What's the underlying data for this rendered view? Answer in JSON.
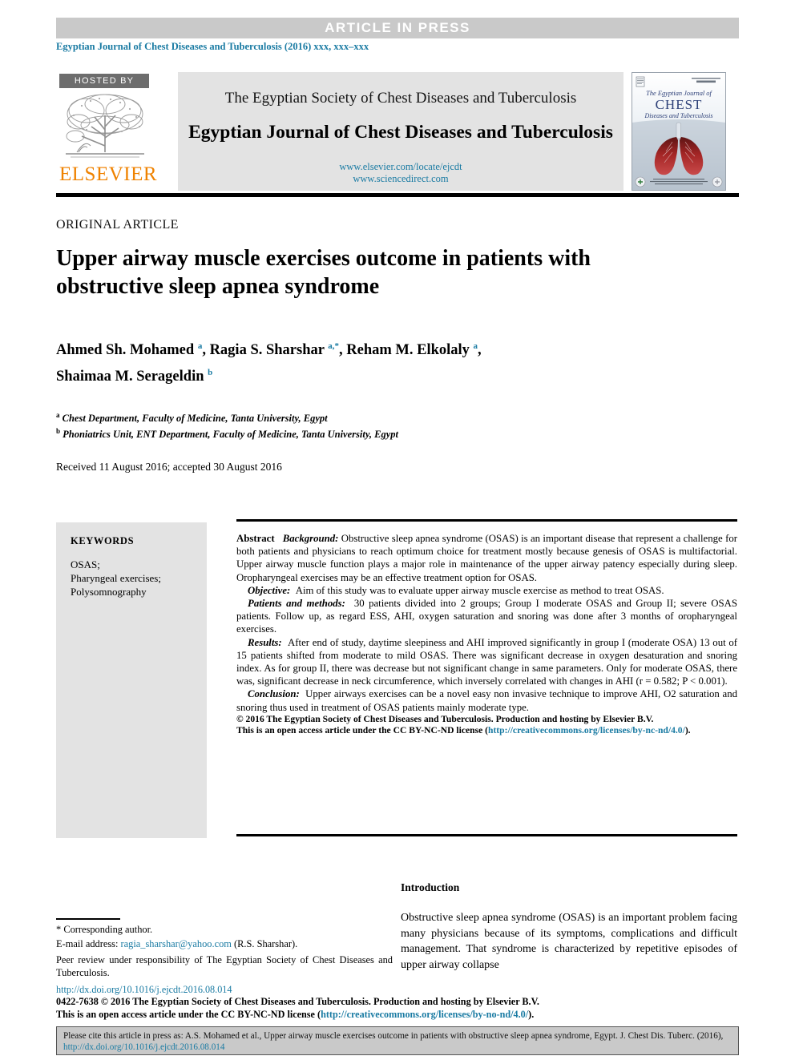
{
  "banner": {
    "label": "ARTICLE  IN  PRESS",
    "journal_reference": "Egyptian Journal of Chest Diseases and Tuberculosis (2016) xxx, xxx–xxx",
    "bar_color": "#c9c9c9",
    "link_color": "#1a7ba3"
  },
  "masthead": {
    "hosted_by": "HOSTED BY",
    "publisher": "ELSEVIER",
    "publisher_color": "#ef8200",
    "society_line": "The Egyptian Society of Chest Diseases and Tuberculosis",
    "journal_name": "Egyptian Journal of Chest Diseases and Tuberculosis",
    "url_elsevier": "www.elsevier.com/locate/ejcdt",
    "url_sciencedirect": "www.sciencedirect.com",
    "cover": {
      "line1": "The Egyptian Journal of",
      "line2": "CHEST",
      "line3": "Diseases and Tuberculosis"
    }
  },
  "article": {
    "kicker": "ORIGINAL ARTICLE",
    "title": "Upper airway muscle exercises outcome in patients with obstructive sleep apnea syndrome",
    "authors_line1": "Ahmed Sh. Mohamed a, Ragia S. Sharshar a,*, Reham M. Elkolaly a,",
    "authors_line2": "Shaimaa M. Serageldin b",
    "affiliation_a": "Chest Department, Faculty of Medicine, Tanta University, Egypt",
    "affiliation_b": "Phoniatrics Unit, ENT Department, Faculty of Medicine, Tanta University, Egypt",
    "received": "Received 11 August 2016; accepted 30 August 2016"
  },
  "keywords": {
    "heading": "KEYWORDS",
    "items": "OSAS;\nPharyngeal exercises;\nPolysomnography"
  },
  "abstract": {
    "label": "Abstract",
    "background_label": "Background:",
    "background_text": "Obstructive sleep apnea syndrome (OSAS) is an important disease that represent a challenge for both patients and physicians to reach optimum choice for treatment mostly because genesis of OSAS is multifactorial. Upper airway muscle function plays a major role in maintenance of the upper airway patency especially during sleep. Oropharyngeal exercises may be an effective treatment option for OSAS.",
    "objective_label": "Objective:",
    "objective_text": "Aim of this study was to evaluate upper airway muscle exercise as method to treat OSAS.",
    "methods_label": "Patients and methods:",
    "methods_text": "30 patients divided into 2 groups; Group I moderate OSAS and Group II; severe OSAS patients. Follow up, as regard ESS, AHI, oxygen saturation and snoring was done after 3 months of oropharyngeal exercises.",
    "results_label": "Results:",
    "results_text": "After end of study, daytime sleepiness and AHI improved significantly in group I (moderate OSA) 13 out of 15 patients shifted from moderate to mild OSAS. There was significant decrease in oxygen desaturation and snoring index. As for group II, there was decrease but not significant change in same parameters. Only for moderate OSAS, there was, significant decrease in neck circumference, which inversely correlated with changes in AHI (r = 0.582; P < 0.001).",
    "conclusion_label": "Conclusion:",
    "conclusion_text": "Upper airways exercises can be a novel easy non invasive technique to improve AHI, O2 saturation and snoring thus used in treatment of OSAS patients mainly moderate type.",
    "copyright_line1": "© 2016 The Egyptian Society of Chest Diseases and Tuberculosis. Production and hosting by Elsevier B.V.",
    "copyright_line2": "This is an open access article under the CC BY-NC-ND license (",
    "copyright_link": "http://creativecommons.org/licenses/by-nc-nd/4.0/",
    "copyright_line3": ")."
  },
  "introduction": {
    "heading": "Introduction",
    "paragraph": "Obstructive sleep apnea syndrome (OSAS) is an important problem facing many physicians because of its symptoms, complications and difficult management. That syndrome is characterized by repetitive episodes of upper airway collapse"
  },
  "footnotes": {
    "corresponding": "Corresponding author.",
    "email_label": "E-mail address:",
    "email": "ragia_sharshar@yahoo.com",
    "email_suffix": "(R.S. Sharshar).",
    "peer_review": "Peer review under responsibility of The Egyptian Society of Chest Diseases and Tuberculosis."
  },
  "bottom": {
    "doi": "http://dx.doi.org/10.1016/j.ejcdt.2016.08.014",
    "issn_line": "0422-7638 © 2016 The Egyptian Society of Chest Diseases and Tuberculosis. Production and hosting by Elsevier B.V.",
    "license_prefix": "This is an open access article under the CC BY-NC-ND license (",
    "license_link": "http://creativecommons.org/licenses/by-no-nd/4.0/",
    "license_suffix": ")."
  },
  "cite_box": {
    "text_part1": "Please cite this article in press as: A.S. Mohamed et al., Upper airway muscle exercises outcome in patients with obstructive sleep apnea syndrome,  Egypt. J. Chest Dis. Tuberc. (2016), ",
    "link": "http://dx.doi.org/10.1016/j.ejcdt.2016.08.014"
  }
}
